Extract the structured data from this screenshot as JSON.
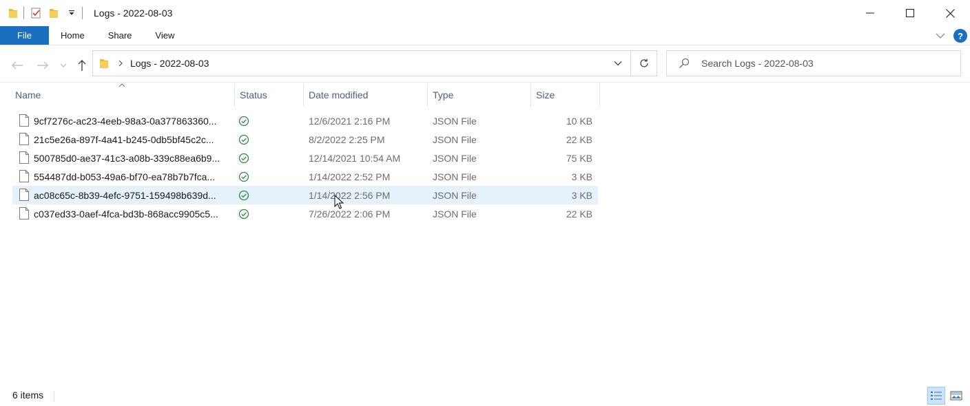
{
  "window": {
    "title": "Logs - 2022-08-03",
    "controls": {
      "minimize_icon": "minimize-icon",
      "maximize_icon": "maximize-icon",
      "close_icon": "close-icon"
    }
  },
  "ribbon": {
    "tabs": [
      {
        "label": "File"
      },
      {
        "label": "Home"
      },
      {
        "label": "Share"
      },
      {
        "label": "View"
      }
    ]
  },
  "address": {
    "crumb": "Logs - 2022-08-03"
  },
  "search": {
    "placeholder": "Search Logs - 2022-08-03"
  },
  "columns": {
    "name": "Name",
    "status": "Status",
    "date": "Date modified",
    "type": "Type",
    "size": "Size"
  },
  "files": [
    {
      "name": "9cf7276c-ac23-4eeb-98a3-0a377863360...",
      "date": "12/6/2021 2:16 PM",
      "type": "JSON File",
      "size": "10 KB"
    },
    {
      "name": "21c5e26a-897f-4a41-b245-0db5bf45c2c...",
      "date": "8/2/2022 2:25 PM",
      "type": "JSON File",
      "size": "22 KB"
    },
    {
      "name": "500785d0-ae37-41c3-a08b-339c88ea6b9...",
      "date": "12/14/2021 10:54 AM",
      "type": "JSON File",
      "size": "75 KB"
    },
    {
      "name": "554487dd-b053-49a6-bf70-ea78b7b7fca...",
      "date": "1/14/2022 2:52 PM",
      "type": "JSON File",
      "size": "3 KB"
    },
    {
      "name": "ac08c65c-8b39-4efc-9751-159498b639d...",
      "date": "1/14/2022 2:56 PM",
      "type": "JSON File",
      "size": "3 KB"
    },
    {
      "name": "c037ed33-0aef-4fca-bd3b-868acc9905c5...",
      "date": "7/26/2022 2:06 PM",
      "type": "JSON File",
      "size": "22 KB"
    }
  ],
  "status_bar": {
    "item_count": "6 items"
  },
  "colors": {
    "accent": "#1a6fc1",
    "hover_row": "#e5f1fb",
    "status_ok": "#2e8b3e"
  }
}
